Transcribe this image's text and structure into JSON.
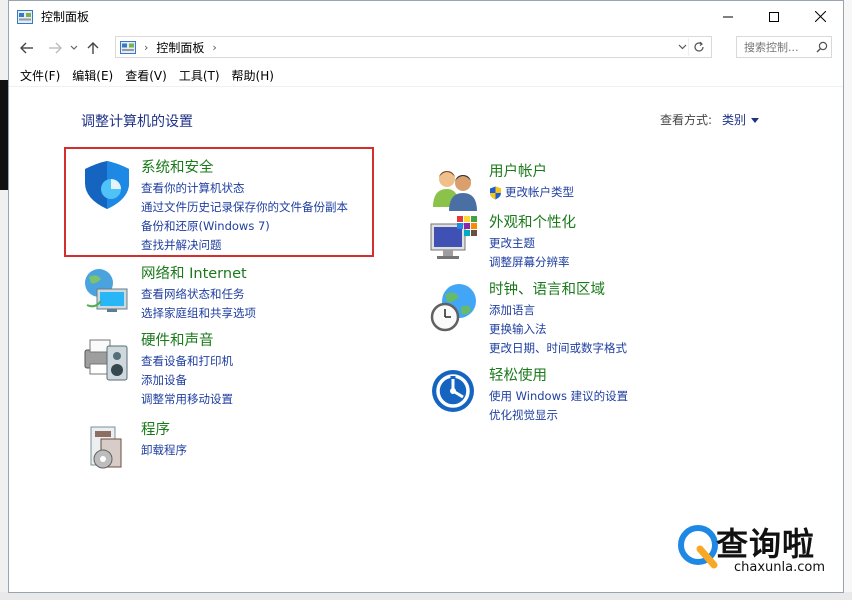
{
  "window": {
    "title": "控制面板"
  },
  "address": {
    "crumb": "控制面板",
    "search_placeholder": "搜索控制..."
  },
  "menu": [
    "文件(F)",
    "编辑(E)",
    "查看(V)",
    "工具(T)",
    "帮助(H)"
  ],
  "main": {
    "heading": "调整计算机的设置",
    "view_by_label": "查看方式:",
    "view_by_value": "类别"
  },
  "categories": {
    "system": {
      "title": "系统和安全",
      "links": [
        "查看你的计算机状态",
        "通过文件历史记录保存你的文件备份副本",
        "备份和还原(Windows 7)",
        "查找并解决问题"
      ]
    },
    "network": {
      "title": "网络和 Internet",
      "links": [
        "查看网络状态和任务",
        "选择家庭组和共享选项"
      ]
    },
    "hardware": {
      "title": "硬件和声音",
      "links": [
        "查看设备和打印机",
        "添加设备",
        "调整常用移动设置"
      ]
    },
    "programs": {
      "title": "程序",
      "links": [
        "卸载程序"
      ]
    },
    "users": {
      "title": "用户帐户",
      "links": [
        "更改帐户类型"
      ]
    },
    "appearance": {
      "title": "外观和个性化",
      "links": [
        "更改主题",
        "调整屏幕分辨率"
      ]
    },
    "clock": {
      "title": "时钟、语言和区域",
      "links": [
        "添加语言",
        "更换输入法",
        "更改日期、时间或数字格式"
      ]
    },
    "ease": {
      "title": "轻松使用",
      "links": [
        "使用 Windows 建议的设置",
        "优化视觉显示"
      ]
    }
  },
  "watermark": {
    "text": "查询啦",
    "url": "chaxunla.com"
  },
  "colors": {
    "title_green": "#1a7a1a",
    "link_blue": "#1f3fa0",
    "highlight_red": "#d32f2f"
  }
}
